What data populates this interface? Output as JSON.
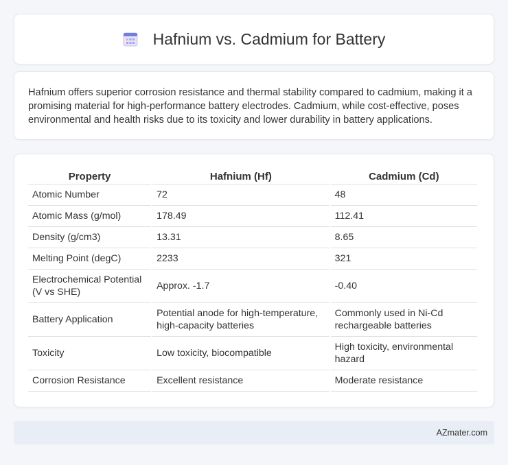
{
  "header": {
    "title": "Hafnium vs. Cadmium for Battery",
    "icon": "calendar-grid-icon"
  },
  "summary": {
    "text": "Hafnium offers superior corrosion resistance and thermal stability compared to cadmium, making it a promising material for high-performance battery electrodes. Cadmium, while cost-effective, poses environmental and health risks due to its toxicity and lower durability in battery applications."
  },
  "table": {
    "headers": [
      "Property",
      "Hafnium (Hf)",
      "Cadmium (Cd)"
    ],
    "rows": [
      [
        "Atomic Number",
        "72",
        "48"
      ],
      [
        "Atomic Mass (g/mol)",
        "178.49",
        "112.41"
      ],
      [
        "Density (g/cm3)",
        "13.31",
        "8.65"
      ],
      [
        "Melting Point (degC)",
        "2233",
        "321"
      ],
      [
        "Electrochemical Potential (V vs SHE)",
        "Approx. -1.7",
        "-0.40"
      ],
      [
        "Battery Application",
        "Potential anode for high-temperature, high-capacity batteries",
        "Commonly used in Ni-Cd rechargeable batteries"
      ],
      [
        "Toxicity",
        "Low toxicity, biocompatible",
        "High toxicity, environmental hazard"
      ],
      [
        "Corrosion Resistance",
        "Excellent resistance",
        "Moderate resistance"
      ]
    ]
  },
  "footer": {
    "text": "AZmater.com"
  }
}
